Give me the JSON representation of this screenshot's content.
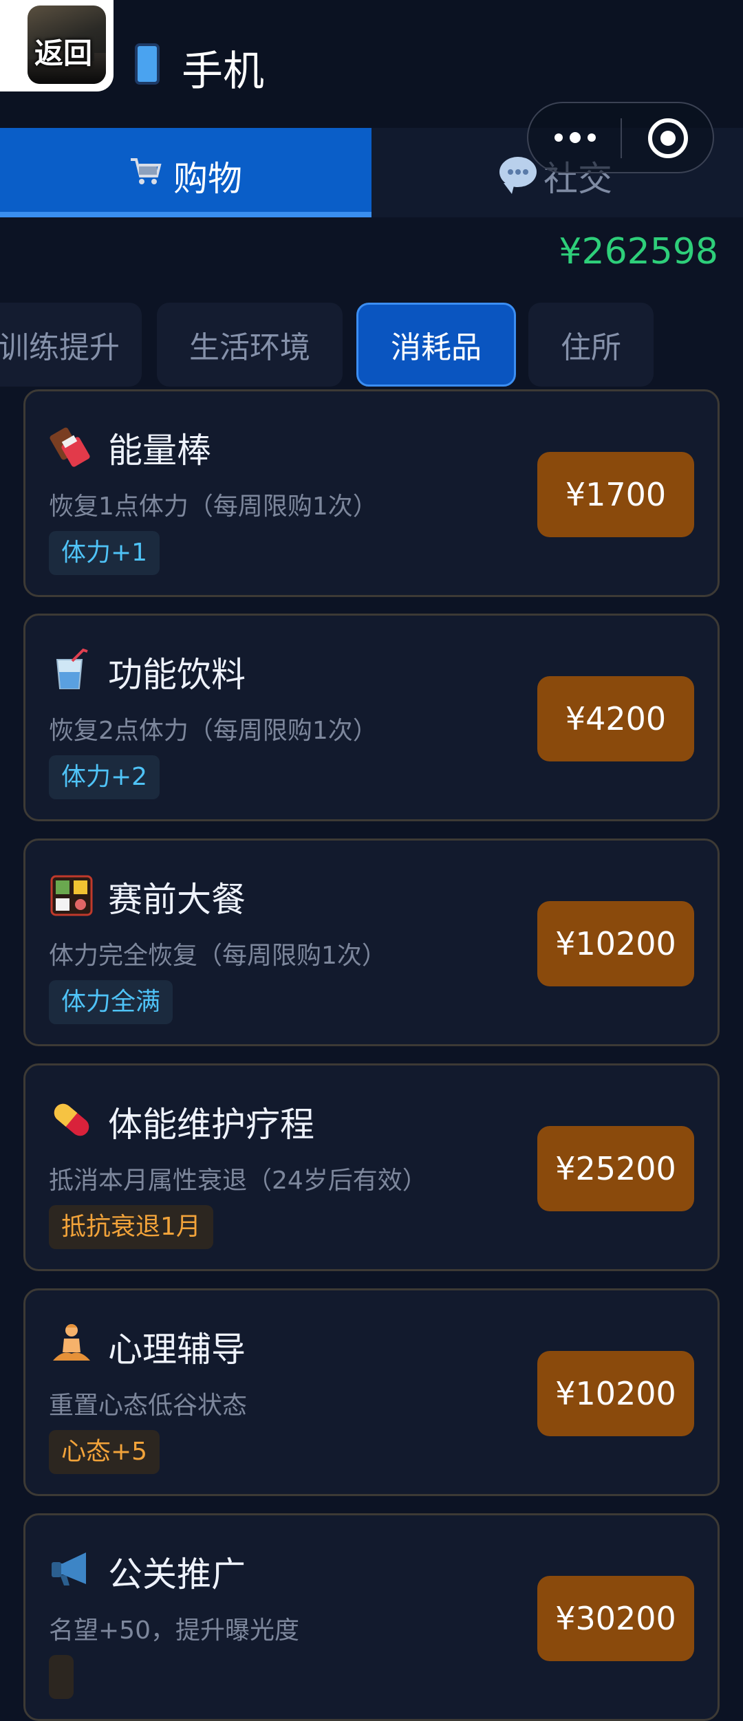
{
  "header": {
    "back_label": "返回",
    "title": "手机",
    "phone_icon": "phone-icon"
  },
  "tabs": [
    {
      "label": "购物",
      "icon": "shopping-cart-icon",
      "active": true
    },
    {
      "label": "社交",
      "icon": "chat-bubble-icon",
      "active": false
    }
  ],
  "capsule": {
    "more_icon": "more-dots-icon",
    "close_icon": "target-circle-icon"
  },
  "balance": "¥262598",
  "categories": [
    {
      "label": "训练提升",
      "active": false
    },
    {
      "label": "生活环境",
      "active": false
    },
    {
      "label": "消耗品",
      "active": true
    },
    {
      "label": "住所",
      "active": false
    }
  ],
  "items": [
    {
      "icon": "chocolate-bar-icon",
      "name": "能量棒",
      "desc": "恢复1点体力（每周限购1次）",
      "tag": "体力+1",
      "tag_color": "#4fc3f7",
      "price": "¥1700"
    },
    {
      "icon": "drink-cup-icon",
      "name": "功能饮料",
      "desc": "恢复2点体力（每周限购1次）",
      "tag": "体力+2",
      "tag_color": "#4fc3f7",
      "price": "¥4200"
    },
    {
      "icon": "bento-box-icon",
      "name": "赛前大餐",
      "desc": "体力完全恢复（每周限购1次）",
      "tag": "体力全满",
      "tag_color": "#4fc3f7",
      "price": "¥10200"
    },
    {
      "icon": "pill-icon",
      "name": "体能维护疗程",
      "desc": "抵消本月属性衰退（24岁后有效）",
      "tag": "抵抗衰退1月",
      "tag_color": "#f2a33a",
      "price": "¥25200"
    },
    {
      "icon": "meditation-person-icon",
      "name": "心理辅导",
      "desc": "重置心态低谷状态",
      "tag": "心态+5",
      "tag_color": "#f2a33a",
      "price": "¥10200"
    },
    {
      "icon": "megaphone-icon",
      "name": "公关推广",
      "desc": "名望+50，提升曝光度",
      "tag": "",
      "tag_color": "#f2a33a",
      "price": "¥30200"
    }
  ]
}
